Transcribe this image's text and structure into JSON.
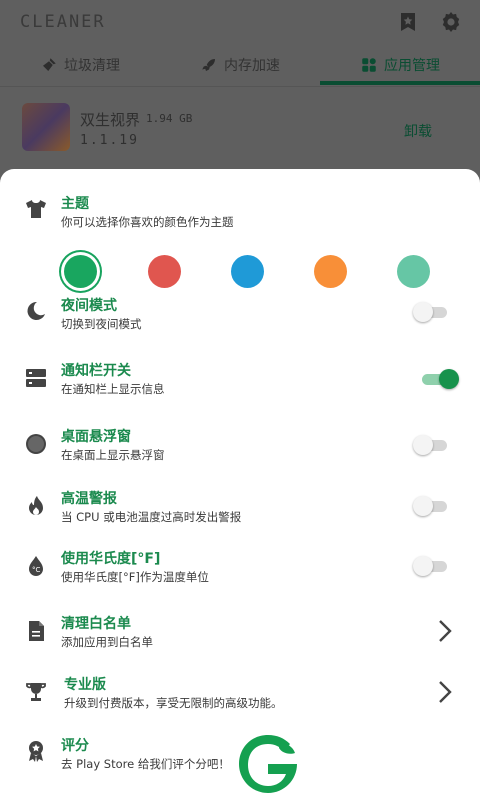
{
  "app_bar": {
    "title": "CLEANER"
  },
  "tabs": [
    {
      "label": "垃圾清理"
    },
    {
      "label": "内存加速"
    },
    {
      "label": "应用管理"
    }
  ],
  "app_item": {
    "name": "双生视界",
    "size": "1.94 GB",
    "version": "1.1.19",
    "action": "卸载"
  },
  "theme": {
    "title": "主题",
    "subtitle": "你可以选择你喜欢的颜色作为主题",
    "colors": [
      "#19a65f",
      "#e0564f",
      "#1f9ad7",
      "#f88f38",
      "#66c6a5"
    ],
    "selected_index": 0
  },
  "settings": [
    {
      "title": "夜间模式",
      "subtitle": "切换到夜间模式",
      "icon": "night-mode-icon",
      "control": "switch",
      "on": false
    },
    {
      "title": "通知栏开关",
      "subtitle": "在通知栏上显示信息",
      "icon": "notification-bar-icon",
      "control": "switch",
      "on": true
    },
    {
      "title": "桌面悬浮窗",
      "subtitle": "在桌面上显示悬浮窗",
      "icon": "floating-window-icon",
      "control": "switch",
      "on": false
    },
    {
      "title": "高温警报",
      "subtitle": "当 CPU 或电池温度过高时发出警报",
      "icon": "flame-icon",
      "control": "switch",
      "on": false
    },
    {
      "title": "使用华氏度[°F]",
      "subtitle": "使用华氏度[°F]作为温度单位",
      "icon": "thermometer-drop-icon",
      "control": "switch",
      "on": false
    },
    {
      "title": "清理白名单",
      "subtitle": "添加应用到白名单",
      "icon": "document-icon",
      "control": "chevron"
    },
    {
      "title": "专业版",
      "subtitle": "升级到付费版本，享受无限制的高级功能。",
      "icon": "trophy-icon",
      "control": "chevron"
    },
    {
      "title": "评分",
      "subtitle": "去 Play Store 给我们评个分吧！",
      "icon": "award-badge-icon",
      "control": "none"
    }
  ],
  "colors": {
    "accent": "#1b8a4e",
    "switch_on": "#17924c",
    "scrim": "#5f5f5f"
  }
}
